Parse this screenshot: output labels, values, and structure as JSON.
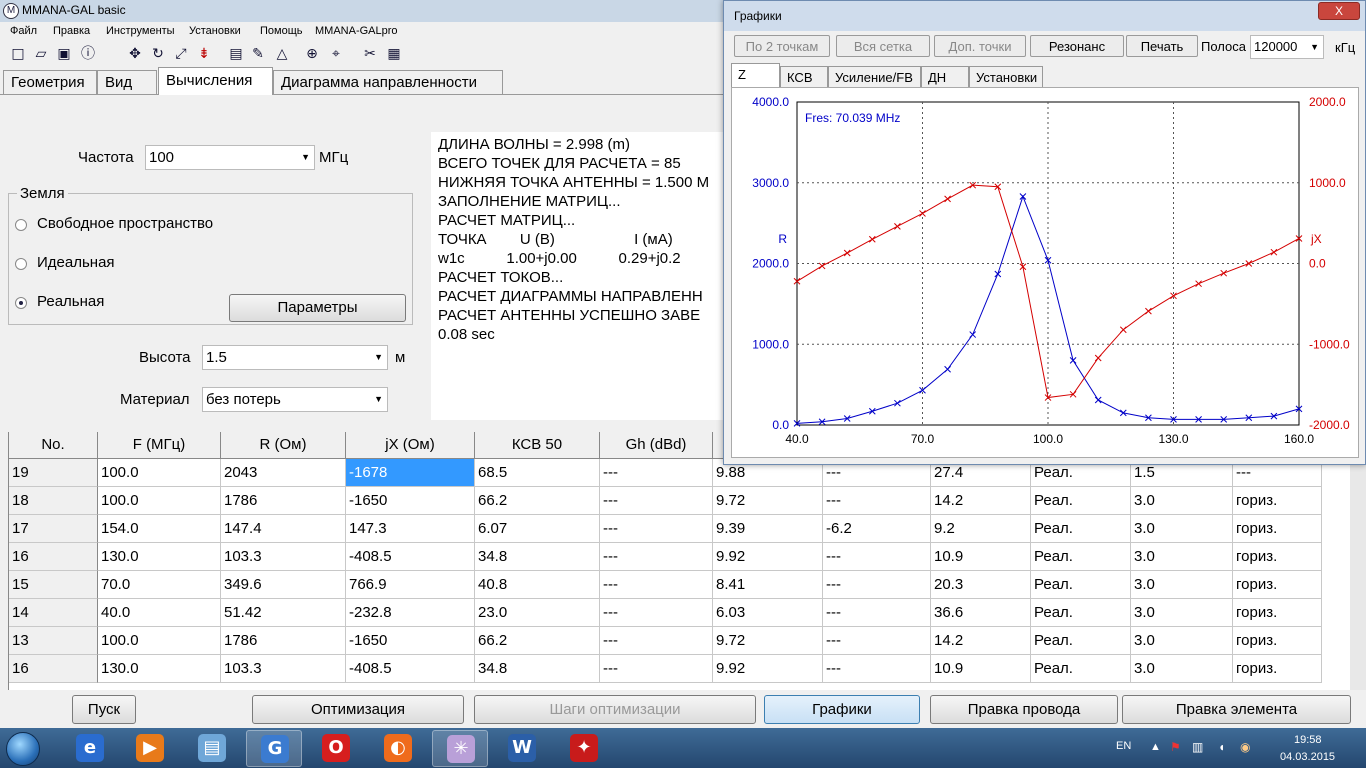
{
  "window": {
    "title": "MMANA-GAL basic"
  },
  "menu": [
    "Файл",
    "Правка",
    "Инструменты",
    "Установки",
    "Помощь",
    "MMANA-GALpro"
  ],
  "toolbar_icons": [
    "new-file-icon",
    "open-folder-icon",
    "save-icon",
    "info-icon",
    "move-icon",
    "rotate-icon",
    "scale-icon",
    "wire-edit-icon",
    "page-icon",
    "pencil-icon",
    "triangle-icon",
    "target-icon",
    "element-icon",
    "tools-icon",
    "calculator-icon"
  ],
  "tabs": [
    "Геометрия",
    "Вид",
    "Вычисления",
    "Диаграмма направленности"
  ],
  "calc": {
    "freq_label": "Частота",
    "freq_value": "100",
    "freq_unit": "МГц",
    "ground_label": "Земля",
    "ground_options": [
      "Свободное пространство",
      "Идеальная",
      "Реальная"
    ],
    "ground_selected": "Реальная",
    "params_button": "Параметры",
    "height_label": "Высота",
    "height_value": "1.5",
    "height_unit": "м",
    "material_label": "Материал",
    "material_value": "без потерь"
  },
  "log": [
    "ДЛИНА ВОЛНЫ = 2.998 (m)",
    "ВСЕГО ТОЧЕК ДЛЯ РАСЧЕТА = 85",
    "НИЖНЯЯ ТОЧКА АНТЕННЫ = 1.500 M",
    "ЗАПОЛНЕНИЕ МАТРИЦ...",
    "РАСЧЕТ МАТРИЦ...",
    "ТОЧКА        U (B)                   I (мA)",
    "w1c          1.00+j0.00          0.29+j0.2",
    "РАСЧЕТ ТОКОВ...",
    "РАСЧЕТ ДИАГРАММЫ НАПРАВЛЕНН",
    "РАСЧЕТ АНТЕННЫ УСПЕШНО ЗАВЕ",
    "0.08 sec"
  ],
  "table": {
    "headers": [
      "No.",
      "F (МГц)",
      "R (Ом)",
      "jX (Ом)",
      "КСВ 50",
      "Gh (dBd)",
      "",
      "",
      "",
      "",
      "",
      ""
    ],
    "rows": [
      [
        "19",
        "100.0",
        "2043",
        "-1678",
        "68.5",
        "---",
        "9.88",
        "---",
        "27.4",
        "Реал.",
        "1.5",
        "---"
      ],
      [
        "18",
        "100.0",
        "1786",
        "-1650",
        "66.2",
        "---",
        "9.72",
        "---",
        "14.2",
        "Реал.",
        "3.0",
        "гориз."
      ],
      [
        "17",
        "154.0",
        "147.4",
        "147.3",
        "6.07",
        "---",
        "9.39",
        "-6.2",
        "9.2",
        "Реал.",
        "3.0",
        "гориз."
      ],
      [
        "16",
        "130.0",
        "103.3",
        "-408.5",
        "34.8",
        "---",
        "9.92",
        "---",
        "10.9",
        "Реал.",
        "3.0",
        "гориз."
      ],
      [
        "15",
        "70.0",
        "349.6",
        "766.9",
        "40.8",
        "---",
        "8.41",
        "---",
        "20.3",
        "Реал.",
        "3.0",
        "гориз."
      ],
      [
        "14",
        "40.0",
        "51.42",
        "-232.8",
        "23.0",
        "---",
        "6.03",
        "---",
        "36.6",
        "Реал.",
        "3.0",
        "гориз."
      ],
      [
        "13",
        "100.0",
        "1786",
        "-1650",
        "66.2",
        "---",
        "9.72",
        "---",
        "14.2",
        "Реал.",
        "3.0",
        "гориз."
      ],
      [
        "16",
        "130.0",
        "103.3",
        "-408.5",
        "34.8",
        "---",
        "9.92",
        "---",
        "10.9",
        "Реал.",
        "3.0",
        "гориз."
      ]
    ]
  },
  "bottom_buttons": [
    "Пуск",
    "Оптимизация",
    "Шаги оптимизации",
    "Графики",
    "Правка провода",
    "Правка элемента"
  ],
  "graphs": {
    "title": "Графики",
    "close_label": "X",
    "buttons": [
      "По 2 точкам",
      "Вся сетка",
      "Доп. точки",
      "Резонанс",
      "Печать"
    ],
    "band_label": "Полоса",
    "band_value": "120000",
    "band_unit": "кГц",
    "tabs": [
      "Z",
      "КСВ",
      "Усиление/FB",
      "ДН",
      "Установки"
    ],
    "fres_label": "Fres: 70.039 MHz"
  },
  "chart_data": {
    "type": "line",
    "x_ticks": [
      "40.0",
      "70.0",
      "100.0",
      "130.0",
      "160.0"
    ],
    "xlim": [
      40,
      160
    ],
    "left_axis": {
      "label": "R",
      "ticks": [
        "4000.0",
        "3000.0",
        "2000.0",
        "1000.0",
        "0.0"
      ],
      "ylim": [
        0,
        4000
      ]
    },
    "right_axis": {
      "label": "jX",
      "ticks": [
        "2000.0",
        "1000.0",
        "0.0",
        "-1000.0",
        "-2000.0"
      ],
      "ylim": [
        -2000,
        2000
      ]
    },
    "grid": true,
    "series": [
      {
        "name": "R",
        "color": "#0000c8",
        "axis": "left",
        "x": [
          40,
          46,
          52,
          58,
          64,
          70,
          76,
          82,
          88,
          94,
          100,
          106,
          112,
          118,
          124,
          130,
          136,
          142,
          148,
          154,
          160
        ],
        "y": [
          20,
          40,
          80,
          170,
          270,
          430,
          690,
          1120,
          1870,
          2830,
          2040,
          800,
          310,
          150,
          90,
          70,
          70,
          70,
          90,
          110,
          200
        ]
      },
      {
        "name": "jX",
        "color": "#d40000",
        "axis": "right",
        "x": [
          40,
          46,
          52,
          58,
          64,
          70,
          76,
          82,
          88,
          94,
          100,
          106,
          112,
          118,
          124,
          130,
          136,
          142,
          148,
          154,
          160
        ],
        "y": [
          -220,
          -30,
          130,
          300,
          460,
          620,
          800,
          970,
          950,
          -40,
          -1660,
          -1620,
          -1170,
          -820,
          -590,
          -400,
          -250,
          -120,
          0,
          140,
          310
        ]
      }
    ]
  },
  "taskbar": {
    "apps": [
      "ie-icon",
      "media-icon",
      "files-icon",
      "mmana-icon",
      "opera-icon",
      "firefox-icon",
      "antenna-icon",
      "word-icon",
      "acrobat-icon"
    ],
    "lang": "EN",
    "time": "19:58",
    "date": "04.03.2015"
  },
  "colors": {
    "r_series": "#0000c8",
    "jx_series": "#d40000",
    "selection": "#3399ff"
  }
}
